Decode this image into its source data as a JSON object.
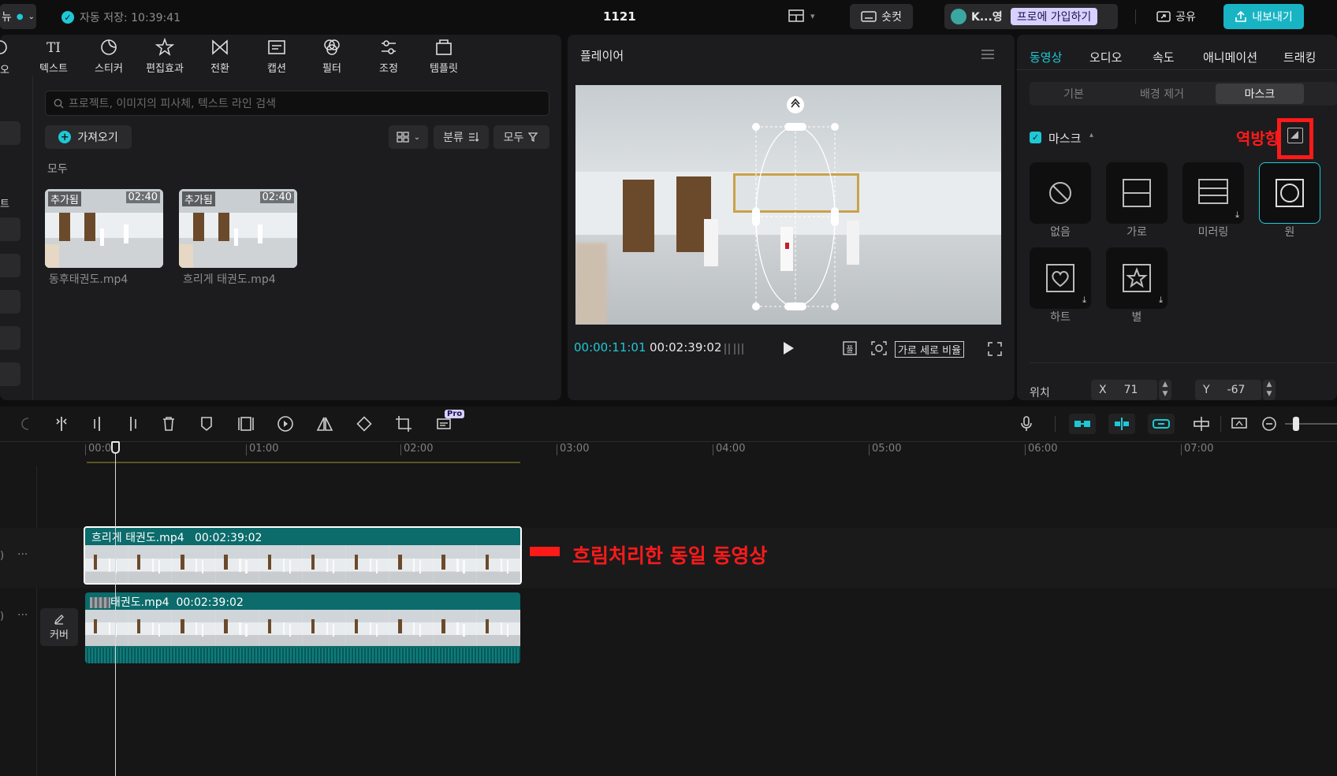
{
  "topbar": {
    "menu_label": "뉴",
    "autosave": "자동 저장: 10:39:41",
    "project_title": "1121",
    "shortcut_label": "숏컷",
    "account_name": "K...영",
    "pro_join_label": "프로에 가입하기",
    "share_label": "공유",
    "export_label": "내보내기"
  },
  "media": {
    "left_edge_labels": [
      "오",
      "트"
    ],
    "categories": [
      {
        "label": "텍스트",
        "icon": "text-icon"
      },
      {
        "label": "스티커",
        "icon": "sticker-icon"
      },
      {
        "label": "편집효과",
        "icon": "effects-icon"
      },
      {
        "label": "전환",
        "icon": "transition-icon"
      },
      {
        "label": "캡션",
        "icon": "caption-icon"
      },
      {
        "label": "필터",
        "icon": "filter-icon"
      },
      {
        "label": "조정",
        "icon": "adjust-icon"
      },
      {
        "label": "템플릿",
        "icon": "template-icon"
      }
    ],
    "search_placeholder": "프로젝트, 이미지의 피사체, 텍스트 라인 검색",
    "import_label": "가져오기",
    "sort_label": "분류",
    "filter_label": "모두",
    "section_label": "모두",
    "items": [
      {
        "tag": "추가됨",
        "duration": "02:40",
        "filename": "동후태권도.mp4"
      },
      {
        "tag": "추가됨",
        "duration": "02:40",
        "filename": "흐리게 태권도.mp4"
      }
    ]
  },
  "player": {
    "title": "플레이어",
    "current_time": "00:00:11:01",
    "total_time": "00:02:39:02",
    "ratio_label": "가로 세로 비율"
  },
  "props": {
    "tabs": [
      "동영상",
      "오디오",
      "속도",
      "애니메이션",
      "트래킹"
    ],
    "active_tab": "동영상",
    "subtabs": [
      "기본",
      "배경 제거",
      "마스크"
    ],
    "active_subtab": "마스크",
    "mask_section_label": "마스크",
    "reverse_annotation": "역방향",
    "mask_types": [
      {
        "label": "없음",
        "icon": "none-icon"
      },
      {
        "label": "가로",
        "icon": "horizontal-icon"
      },
      {
        "label": "미러링",
        "icon": "mirror-icon"
      },
      {
        "label": "원",
        "icon": "circle-icon"
      },
      {
        "label": "하트",
        "icon": "heart-icon"
      },
      {
        "label": "별",
        "icon": "star-icon"
      }
    ],
    "selected_mask": "원",
    "position_label": "위치",
    "x_label": "X",
    "x_value": "71",
    "y_label": "Y",
    "y_value": "-67"
  },
  "timeline": {
    "pro_badge": "Pro",
    "ruler": [
      "00:0",
      "01:00",
      "02:00",
      "03:00",
      "04:00",
      "05:00",
      "06:00",
      "07:00"
    ],
    "clips": [
      {
        "name": "흐리게 태권도.mp4",
        "duration": "00:02:39:02"
      },
      {
        "name": "태권도.mp4",
        "duration": "00:02:39:02"
      }
    ],
    "cover_label": "커버",
    "annotation": "흐림처리한 동일 동영상"
  },
  "colors": {
    "accent": "#1ec8d6",
    "annotation_red": "#ff1a1a",
    "export_bg": "#19b4c4",
    "pro_badge_bg": "#d8d1ff"
  }
}
